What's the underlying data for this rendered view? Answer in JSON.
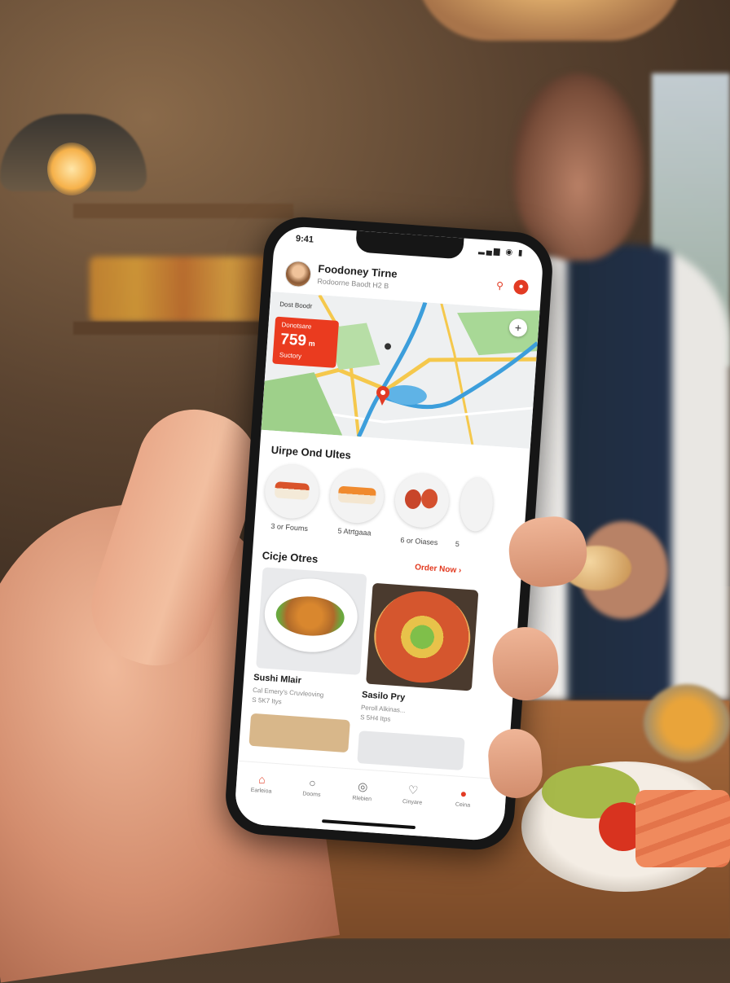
{
  "status": {
    "time": "9:41",
    "icons": "▂▄▆ ◉ ▮"
  },
  "header": {
    "title": "Foodoney Tirne",
    "subtitle": "Rodoorne Baodt H2 B"
  },
  "map": {
    "top_label": "Dost Boodr",
    "badge_top": "Donotsare",
    "badge_price": "759",
    "badge_unit": "m",
    "badge_bottom": "Suctory",
    "plus": "+"
  },
  "section1": {
    "title": "Uirpe Ond Ultes",
    "items": [
      {
        "label": "3 or Foums"
      },
      {
        "label": "5 Atrtgaaa"
      },
      {
        "label": "6 or Oiases"
      },
      {
        "label": "5"
      }
    ]
  },
  "section2": {
    "title": "Cicje Otres",
    "order_now": "Order Now ›",
    "cards": [
      {
        "title": "Sushi Mlair",
        "sub1": "Cal Emery's Cruvleoving",
        "sub2": "S 5K7 Itys"
      },
      {
        "title": "Sasilo Pry",
        "sub1": "Peroll Alkinas...",
        "sub2": "S 5H4 Itps"
      }
    ]
  },
  "tabbar": [
    {
      "label": "Earleioa",
      "icon": "home-icon"
    },
    {
      "label": "Dooms",
      "icon": "search-icon"
    },
    {
      "label": "Rlebien",
      "icon": "orders-icon"
    },
    {
      "label": "Cinyare",
      "icon": "heart-icon"
    },
    {
      "label": "Ceina",
      "icon": "profile-icon"
    }
  ],
  "colors": {
    "accent": "#e23b24",
    "map_road": "#f5c84c",
    "map_river": "#3c9edb",
    "map_green": "#9ed08a"
  }
}
